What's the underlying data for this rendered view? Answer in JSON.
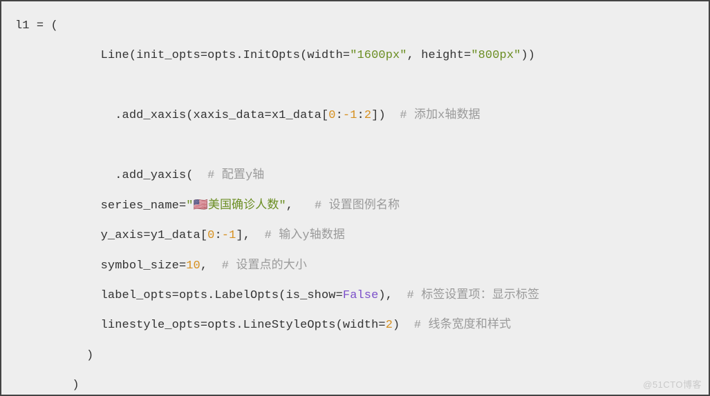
{
  "code": {
    "line1": {
      "a": "l1 = ("
    },
    "line2": {
      "a": "            Line(init_opts=opts.InitOpts(width=",
      "s1": "\"1600px\"",
      "b": ", height=",
      "s2": "\"800px\"",
      "c": "))"
    },
    "blank1": "",
    "line3": {
      "a": "              .add_xaxis(xaxis_data=x1_data[",
      "n1": "0",
      "b": ":",
      "n2": "-1",
      "c": ":",
      "n3": "2",
      "d": "])  ",
      "cm": "# 添加x轴数据"
    },
    "blank2": "",
    "line4": {
      "a": "              .add_yaxis(  ",
      "cm": "# 配置y轴"
    },
    "line5": {
      "a": "            series_name=",
      "q1": "\"",
      "flag": "🇺🇸",
      "s1": "美国确诊人数",
      "q2": "\"",
      "b": ",   ",
      "cm": "# 设置图例名称"
    },
    "line6": {
      "a": "            y_axis=y1_data[",
      "n1": "0",
      "b": ":",
      "n2": "-1",
      "c": "],  ",
      "cm": "# 输入y轴数据"
    },
    "line7": {
      "a": "            symbol_size=",
      "n1": "10",
      "b": ",  ",
      "cm": "# 设置点的大小"
    },
    "line8": {
      "a": "            label_opts=opts.LabelOpts(is_show=",
      "cst": "False",
      "b": "),  ",
      "cm": "# 标签设置项：显示标签"
    },
    "line9": {
      "a": "            linestyle_opts=opts.LineStyleOpts(width=",
      "n1": "2",
      "b": ")  ",
      "cm": "# 线条宽度和样式"
    },
    "line10": {
      "a": "          )"
    },
    "line11": {
      "a": "        )"
    }
  },
  "watermark": "@51CTO博客"
}
